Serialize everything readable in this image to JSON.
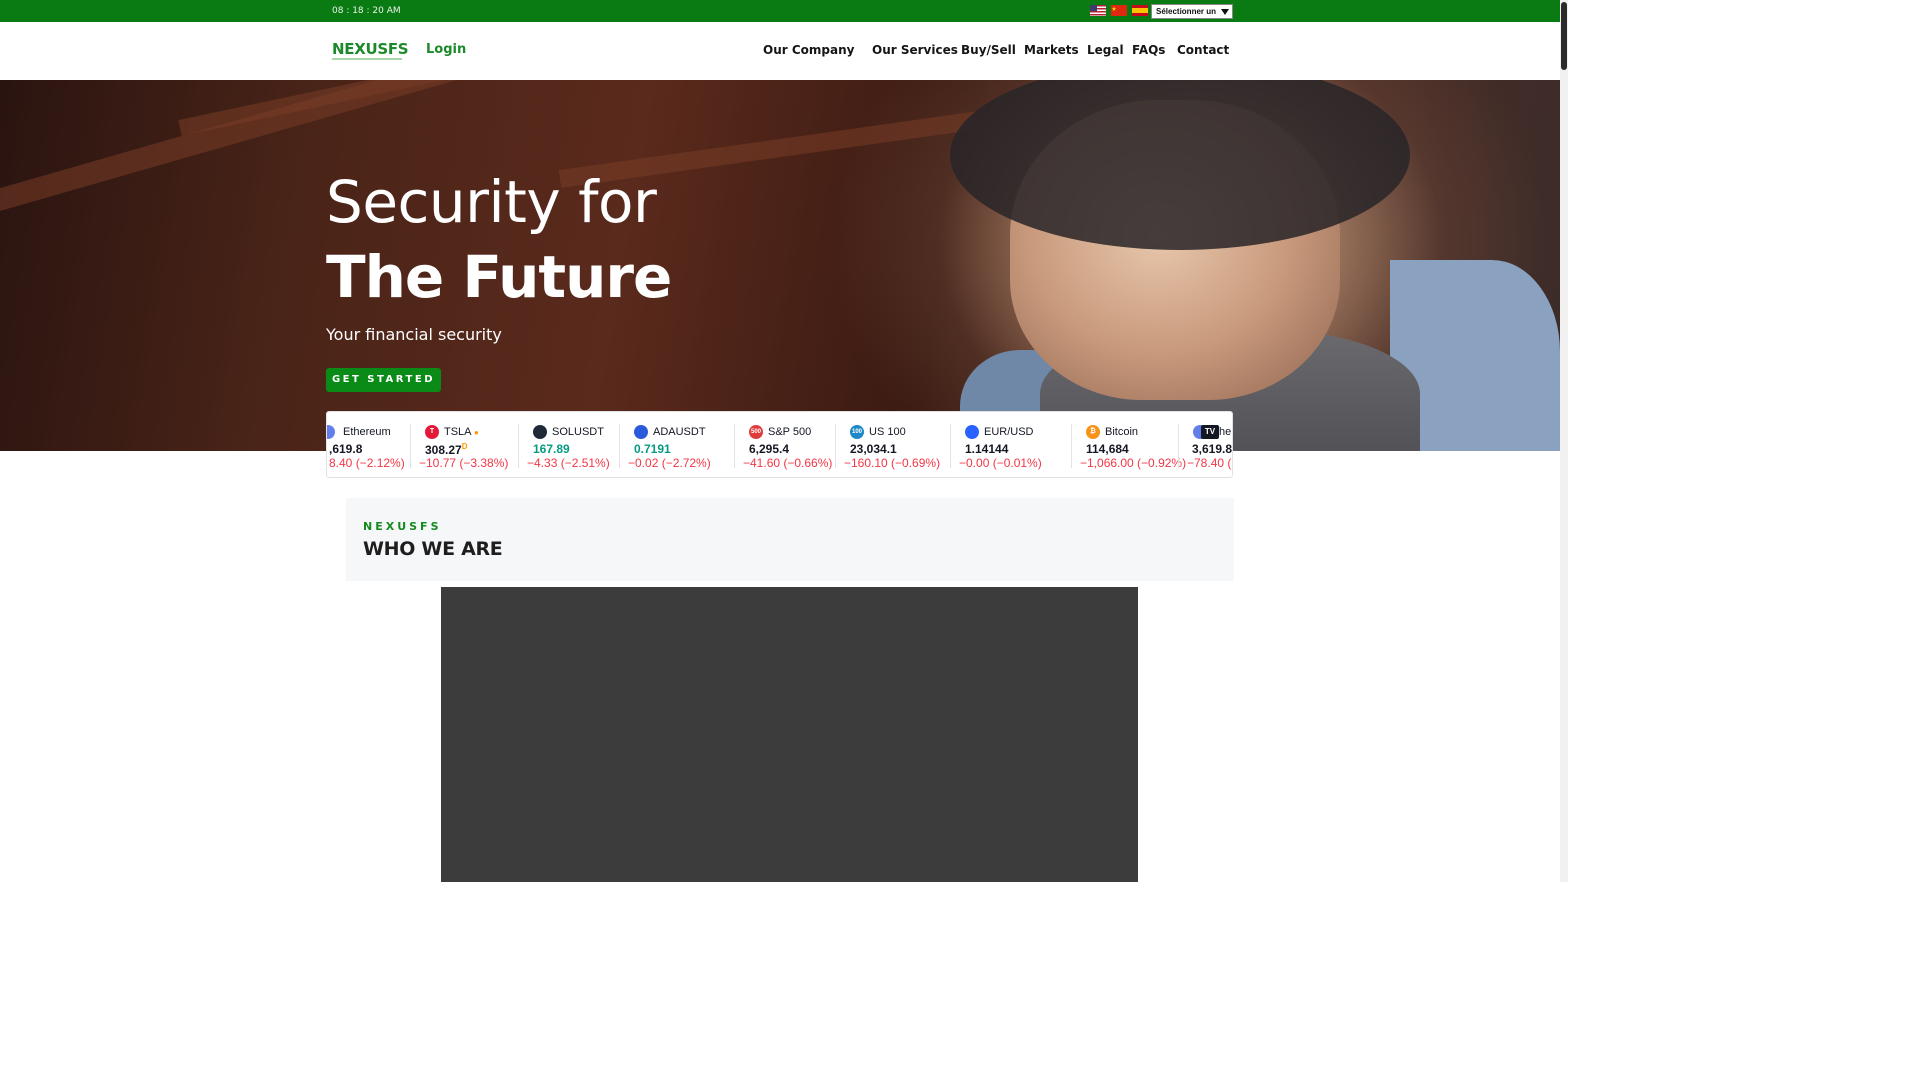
{
  "topbar": {
    "clock": "08 : 18 : 20 AM",
    "language_select": "Sélectionner un",
    "flags": [
      "us-flag-icon",
      "china-flag-icon",
      "spain-flag-icon"
    ]
  },
  "nav": {
    "logo": "NEXUSFS",
    "login": " Login",
    "login_icon": "user-icon",
    "items": [
      {
        "label": "Our Company "
      },
      {
        "label": "Our Services"
      },
      {
        "label": "Buy/Sell"
      },
      {
        "label": "Markets"
      },
      {
        "label": "Legal"
      },
      {
        "label": "FAQs"
      },
      {
        "label": "Contact"
      }
    ]
  },
  "hero": {
    "title_line1": "Security for",
    "title_line2": "The Future",
    "subtitle": "Your financial security",
    "cta": "GET STARTED"
  },
  "ticker": [
    {
      "name": "Ethereum",
      "price": ",619.8",
      "change": "8.40 (−2.12%)",
      "icon": "ethereum-icon",
      "color": "#627eea"
    },
    {
      "name": "TSLA",
      "price": "308.27",
      "change": "−10.77 (−3.38%)",
      "icon": "tesla-icon",
      "color": "#e31937",
      "price_flag": "D"
    },
    {
      "name": "SOLUSDT",
      "price": "167.89",
      "change": "−4.33 (−2.51%)",
      "icon": "solana-icon",
      "color": "#1f2937"
    },
    {
      "name": "ADAUSDT",
      "price": "0.7191",
      "change": "−0.02 (−2.72%)",
      "icon": "cardano-icon",
      "color": "#2a5ada"
    },
    {
      "name": "S&P 500",
      "price": "6,295.4",
      "change": "−41.60 (−0.66%)",
      "icon": "sp500-icon",
      "color": "#e03c3c",
      "icon_text": "500"
    },
    {
      "name": "US 100",
      "price": "23,034.1",
      "change": "−160.10 (−0.69%)",
      "icon": "us100-icon",
      "color": "#1e88c8",
      "icon_text": "100"
    },
    {
      "name": "EUR/USD",
      "price": "1.14144",
      "change": "−0.00 (−0.01%)",
      "icon": "eurusd-icon",
      "color": "#2962ff"
    },
    {
      "name": "Bitcoin",
      "price": "114,684",
      "change": "−1,066.00 (−0.92%)",
      "icon": "bitcoin-icon",
      "color": "#f7931a",
      "icon_text": "₿"
    },
    {
      "name": "he",
      "price": "3,619.8",
      "change": "−78.40 (",
      "icon": "tradingview-icon",
      "color": "#131722"
    }
  ],
  "who": {
    "kicker": "NEXUSFS",
    "title": "WHO WE ARE"
  },
  "colors": {
    "brand_green": "#0a7a12",
    "negative": "#f23645",
    "positive": "#089981"
  }
}
